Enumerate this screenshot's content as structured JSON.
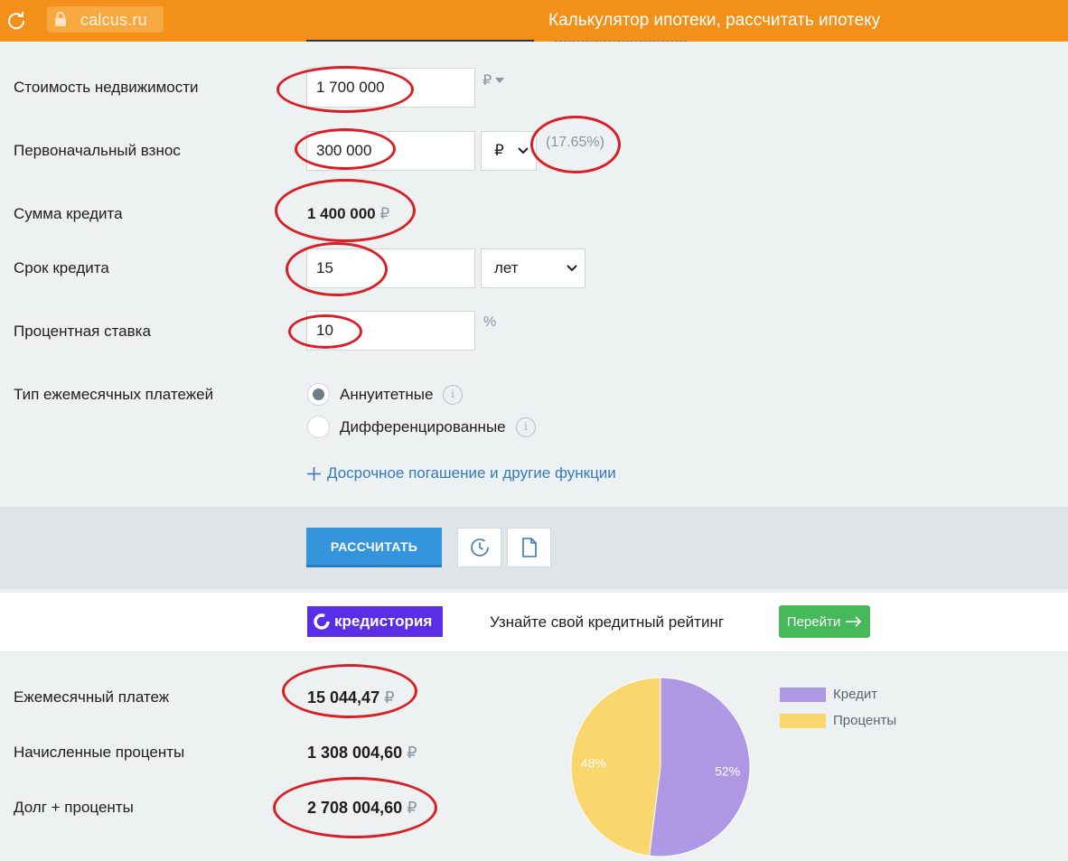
{
  "browser": {
    "url": "calcus.ru",
    "page_title": "Калькулятор ипотеки, рассчитать ипотеку"
  },
  "form": {
    "property_cost": {
      "label": "Стоимость недвижимости",
      "value": "1 700 000",
      "currency": "₽"
    },
    "down_payment": {
      "label": "Первоначальный взнос",
      "value": "300 000",
      "unit": "₽",
      "percent": "(17.65%)"
    },
    "loan_amount": {
      "label": "Сумма кредита",
      "value": "1 400 000",
      "currency": "₽"
    },
    "loan_term": {
      "label": "Срок кредита",
      "value": "15",
      "unit": "лет"
    },
    "interest_rate": {
      "label": "Процентная ставка",
      "value": "10",
      "unit": "%"
    },
    "payment_type": {
      "label": "Тип ежемесячных платежей",
      "options": [
        "Аннуитетные",
        "Дифференцированные"
      ],
      "selected": "Аннуитетные"
    },
    "more_link": "Досрочное погашение и другие функции"
  },
  "actions": {
    "calculate": "РАССЧИТАТЬ"
  },
  "promo": {
    "logo": "кредистория",
    "text": "Узнайте свой кредитный рейтинг",
    "button": "Перейти"
  },
  "results": {
    "monthly_payment": {
      "label": "Ежемесячный платеж",
      "value": "15 044,47",
      "currency": "₽"
    },
    "accrued_interest": {
      "label": "Начисленные проценты",
      "value": "1 308 004,60",
      "currency": "₽"
    },
    "total": {
      "label": "Долг + проценты",
      "value": "2 708 004,60",
      "currency": "₽"
    }
  },
  "chart_data": {
    "type": "pie",
    "slices": [
      {
        "name": "Кредит",
        "value": 52,
        "label": "52%",
        "color": "#ae98e4"
      },
      {
        "name": "Проценты",
        "value": 48,
        "label": "48%",
        "color": "#f9d66e"
      }
    ],
    "legend": "right"
  },
  "colors": {
    "accent": "#f39019",
    "primary_button": "#3595dc",
    "go_button": "#46b95a",
    "annotation": "#d81f26"
  }
}
